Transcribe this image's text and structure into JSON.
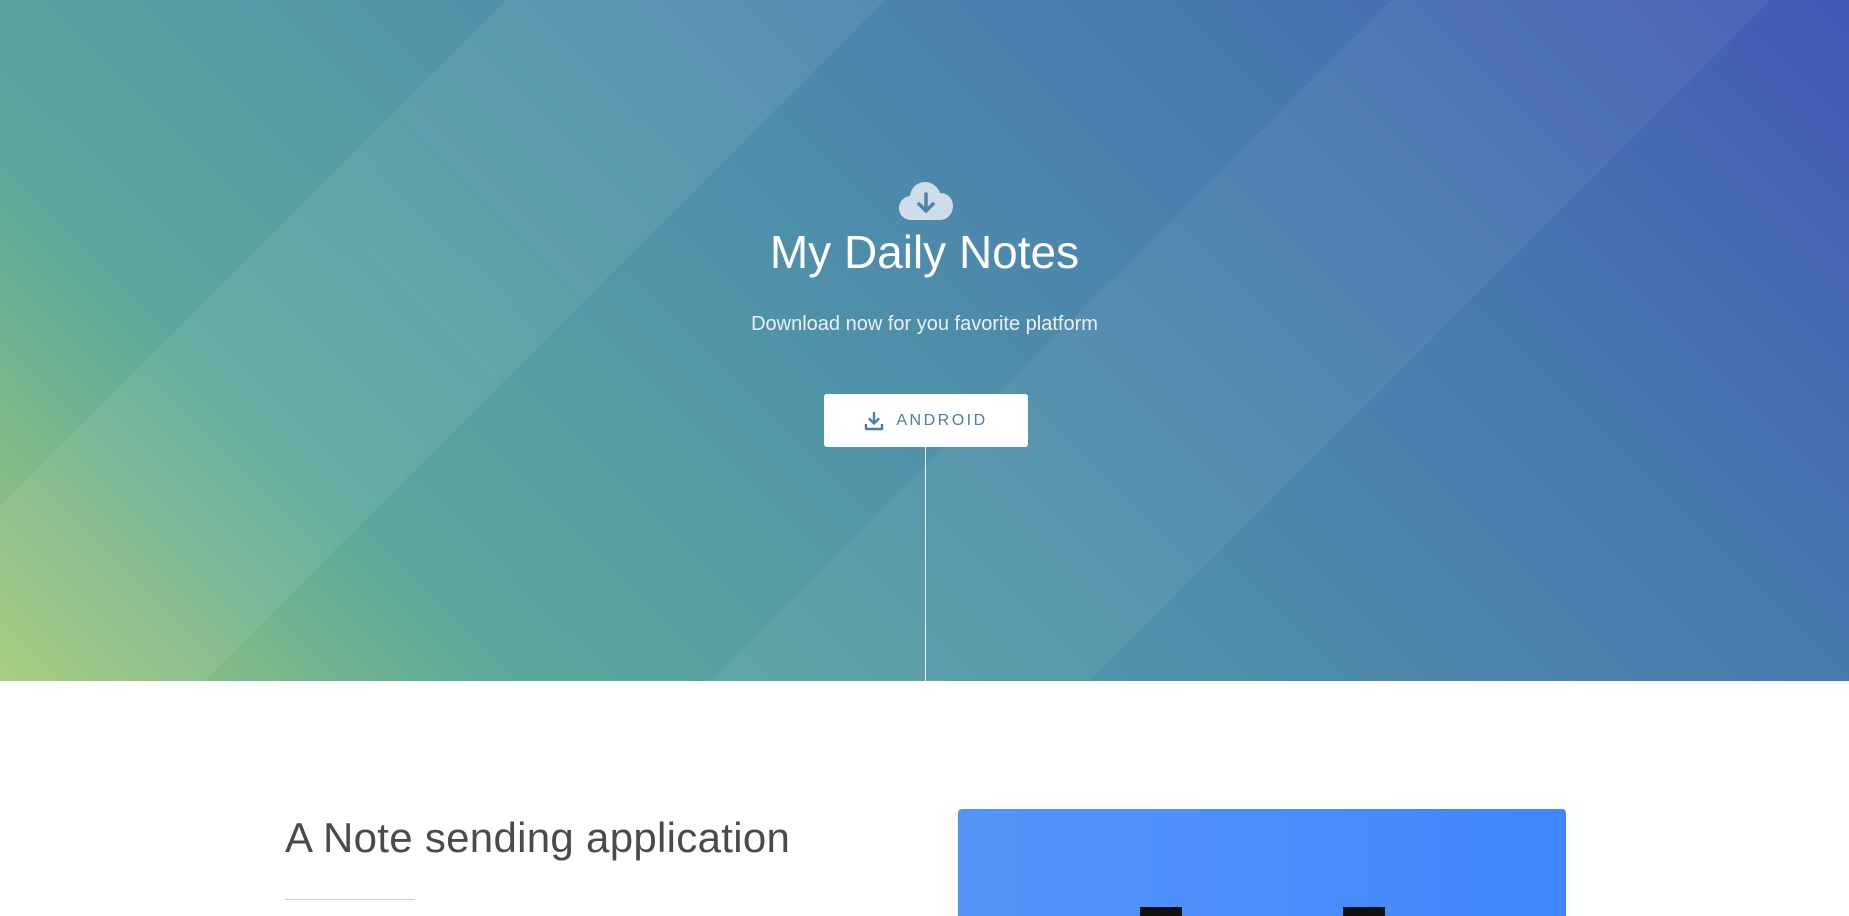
{
  "hero": {
    "icon": "cloud-download-icon",
    "title": "My Daily Notes",
    "subtitle": "Download now for you favorite platform",
    "button": {
      "icon": "download-icon",
      "label": "ANDROID"
    }
  },
  "features": {
    "heading": "A Note sending application",
    "image": "app-preview-image"
  },
  "colors": {
    "hero_gradient_start": "#a2c977",
    "hero_gradient_mid": "#4f93a8",
    "hero_gradient_end": "#4259b5",
    "button_text": "#4e7e9e",
    "preview_blue": "#4a8cfb"
  }
}
